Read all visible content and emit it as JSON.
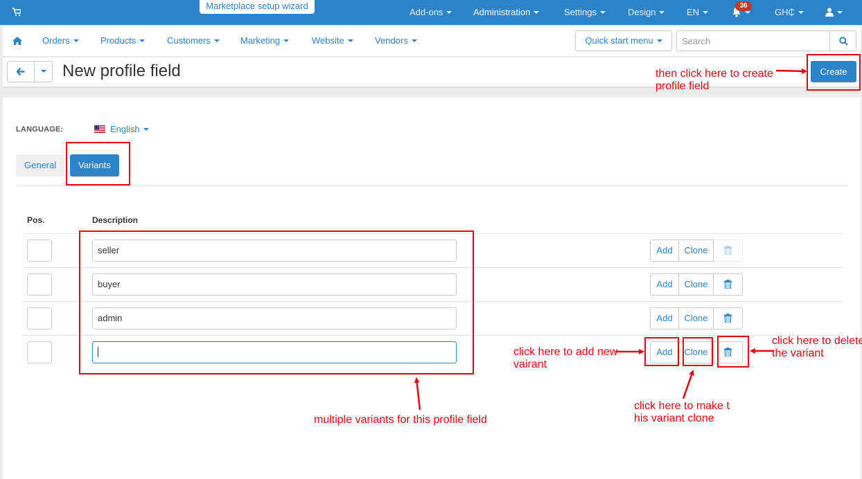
{
  "topbar": {
    "wizard": "Marketplace setup wizard",
    "items": [
      {
        "label": "Add-ons"
      },
      {
        "label": "Administration"
      },
      {
        "label": "Settings"
      },
      {
        "label": "Design"
      },
      {
        "label": "EN"
      }
    ],
    "notification_count": "36",
    "currency": "GH₵"
  },
  "mainnav": {
    "items": [
      {
        "label": "Orders"
      },
      {
        "label": "Products"
      },
      {
        "label": "Customers"
      },
      {
        "label": "Marketing"
      },
      {
        "label": "Website"
      },
      {
        "label": "Vendors"
      }
    ],
    "quick_start": "Quick start menu",
    "search_placeholder": "Search"
  },
  "page": {
    "title": "New profile field",
    "create_label": "Create"
  },
  "language": {
    "label": "LANGUAGE:",
    "value": "English"
  },
  "tabs": [
    {
      "label": "General"
    },
    {
      "label": "Variants"
    }
  ],
  "table": {
    "columns": [
      "Pos.",
      "Description"
    ],
    "rows": [
      {
        "pos": "",
        "description": "seller"
      },
      {
        "pos": "",
        "description": "buyer"
      },
      {
        "pos": "",
        "description": "admin"
      },
      {
        "pos": "",
        "description": ""
      }
    ],
    "add_label": "Add",
    "clone_label": "Clone"
  },
  "annotations": {
    "create_line1": "then click here to create",
    "create_line2": "profile field",
    "variants_note": "multiple variants for this profile field",
    "add_line1": "click here to add new",
    "add_line2": "vairant",
    "clone_line1": "click here to make t",
    "clone_line2": "his variant clone",
    "delete_line1": "click here to delete",
    "delete_line2": "the variant"
  },
  "colors": {
    "primary": "#2d83c8",
    "annotation": "#e8000f",
    "badge": "#c0392b"
  }
}
